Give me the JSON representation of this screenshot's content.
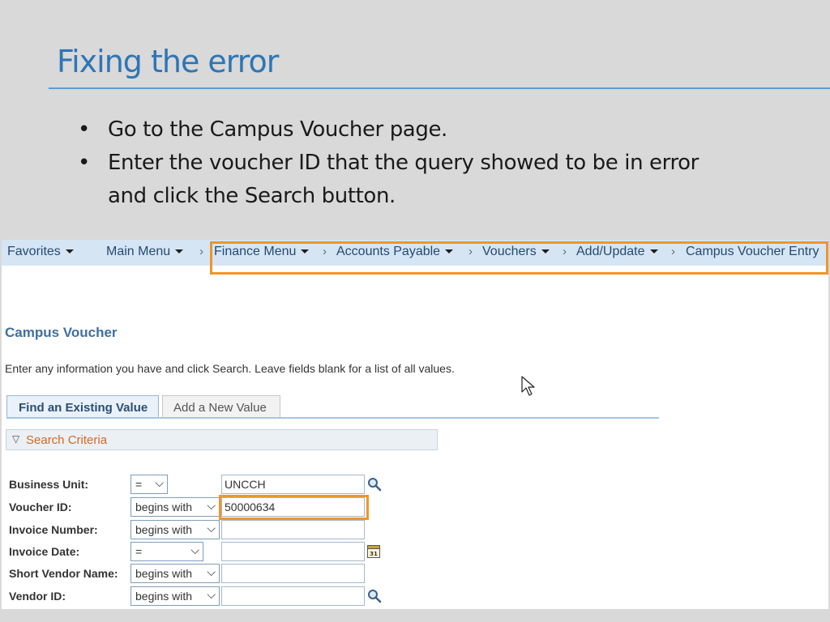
{
  "slide": {
    "title": "Fixing the error",
    "bullets": [
      "Go to the Campus Voucher page.",
      "Enter the voucher ID that the query showed to be in error and click the Search button."
    ],
    "bullet_glyph": "•"
  },
  "nav": {
    "favorites": "Favorites",
    "main_menu": "Main Menu",
    "breadcrumb": [
      "Finance Menu",
      "Accounts Payable",
      "Vouchers",
      "Add/Update",
      "Campus Voucher Entry"
    ],
    "separator": "›"
  },
  "page": {
    "heading": "Campus Voucher",
    "instructions": "Enter any information you have and click Search. Leave fields blank for a list of all values.",
    "tabs": [
      "Find an Existing Value",
      "Add a New Value"
    ],
    "search_criteria": "Search Criteria"
  },
  "fields": [
    {
      "label": "Business Unit:",
      "operator": "=",
      "value": "UNCCH",
      "icon": "lookup-icon"
    },
    {
      "label": "Voucher ID:",
      "operator": "begins with",
      "value": "50000634",
      "icon": ""
    },
    {
      "label": "Invoice Number:",
      "operator": "begins with",
      "value": "",
      "icon": ""
    },
    {
      "label": "Invoice Date:",
      "operator": "=",
      "value": "",
      "icon": "calendar-icon"
    },
    {
      "label": "Short Vendor Name:",
      "operator": "begins with",
      "value": "",
      "icon": ""
    },
    {
      "label": "Vendor ID:",
      "operator": "begins with",
      "value": "",
      "icon": "lookup-icon"
    }
  ],
  "colors": {
    "title_blue": "#2e75b6",
    "highlight_orange": "#f0952a",
    "nav_background": "#d6e5f4",
    "criteria_orange": "#d06a23"
  }
}
